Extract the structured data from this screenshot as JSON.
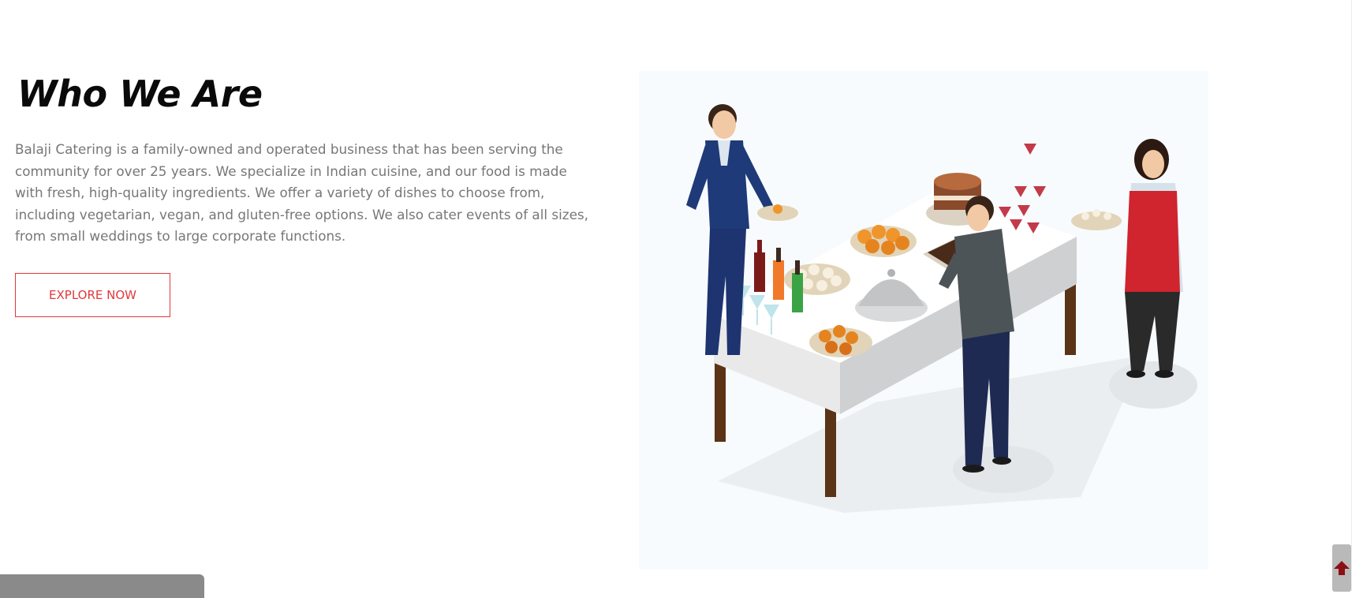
{
  "about": {
    "title": "Who We Are",
    "description": "Balaji Catering is a family-owned and operated business that has been serving the community for over 25 years. We specialize in Indian cuisine, and our food is made with fresh, high-quality ingredients. We offer a variety of dishes to choose from, including vegetarian, vegan, and gluten-free options. We also cater events of all sizes, from small weddings to large corporate functions.",
    "button_label": "EXPLORE NOW"
  },
  "colors": {
    "accent": "#e0393c",
    "heading": "#0a0a0a",
    "body_text": "#777777",
    "back_to_top_arrow": "#8b0f14"
  },
  "icons": {
    "back_to_top": "arrow-up-icon"
  }
}
